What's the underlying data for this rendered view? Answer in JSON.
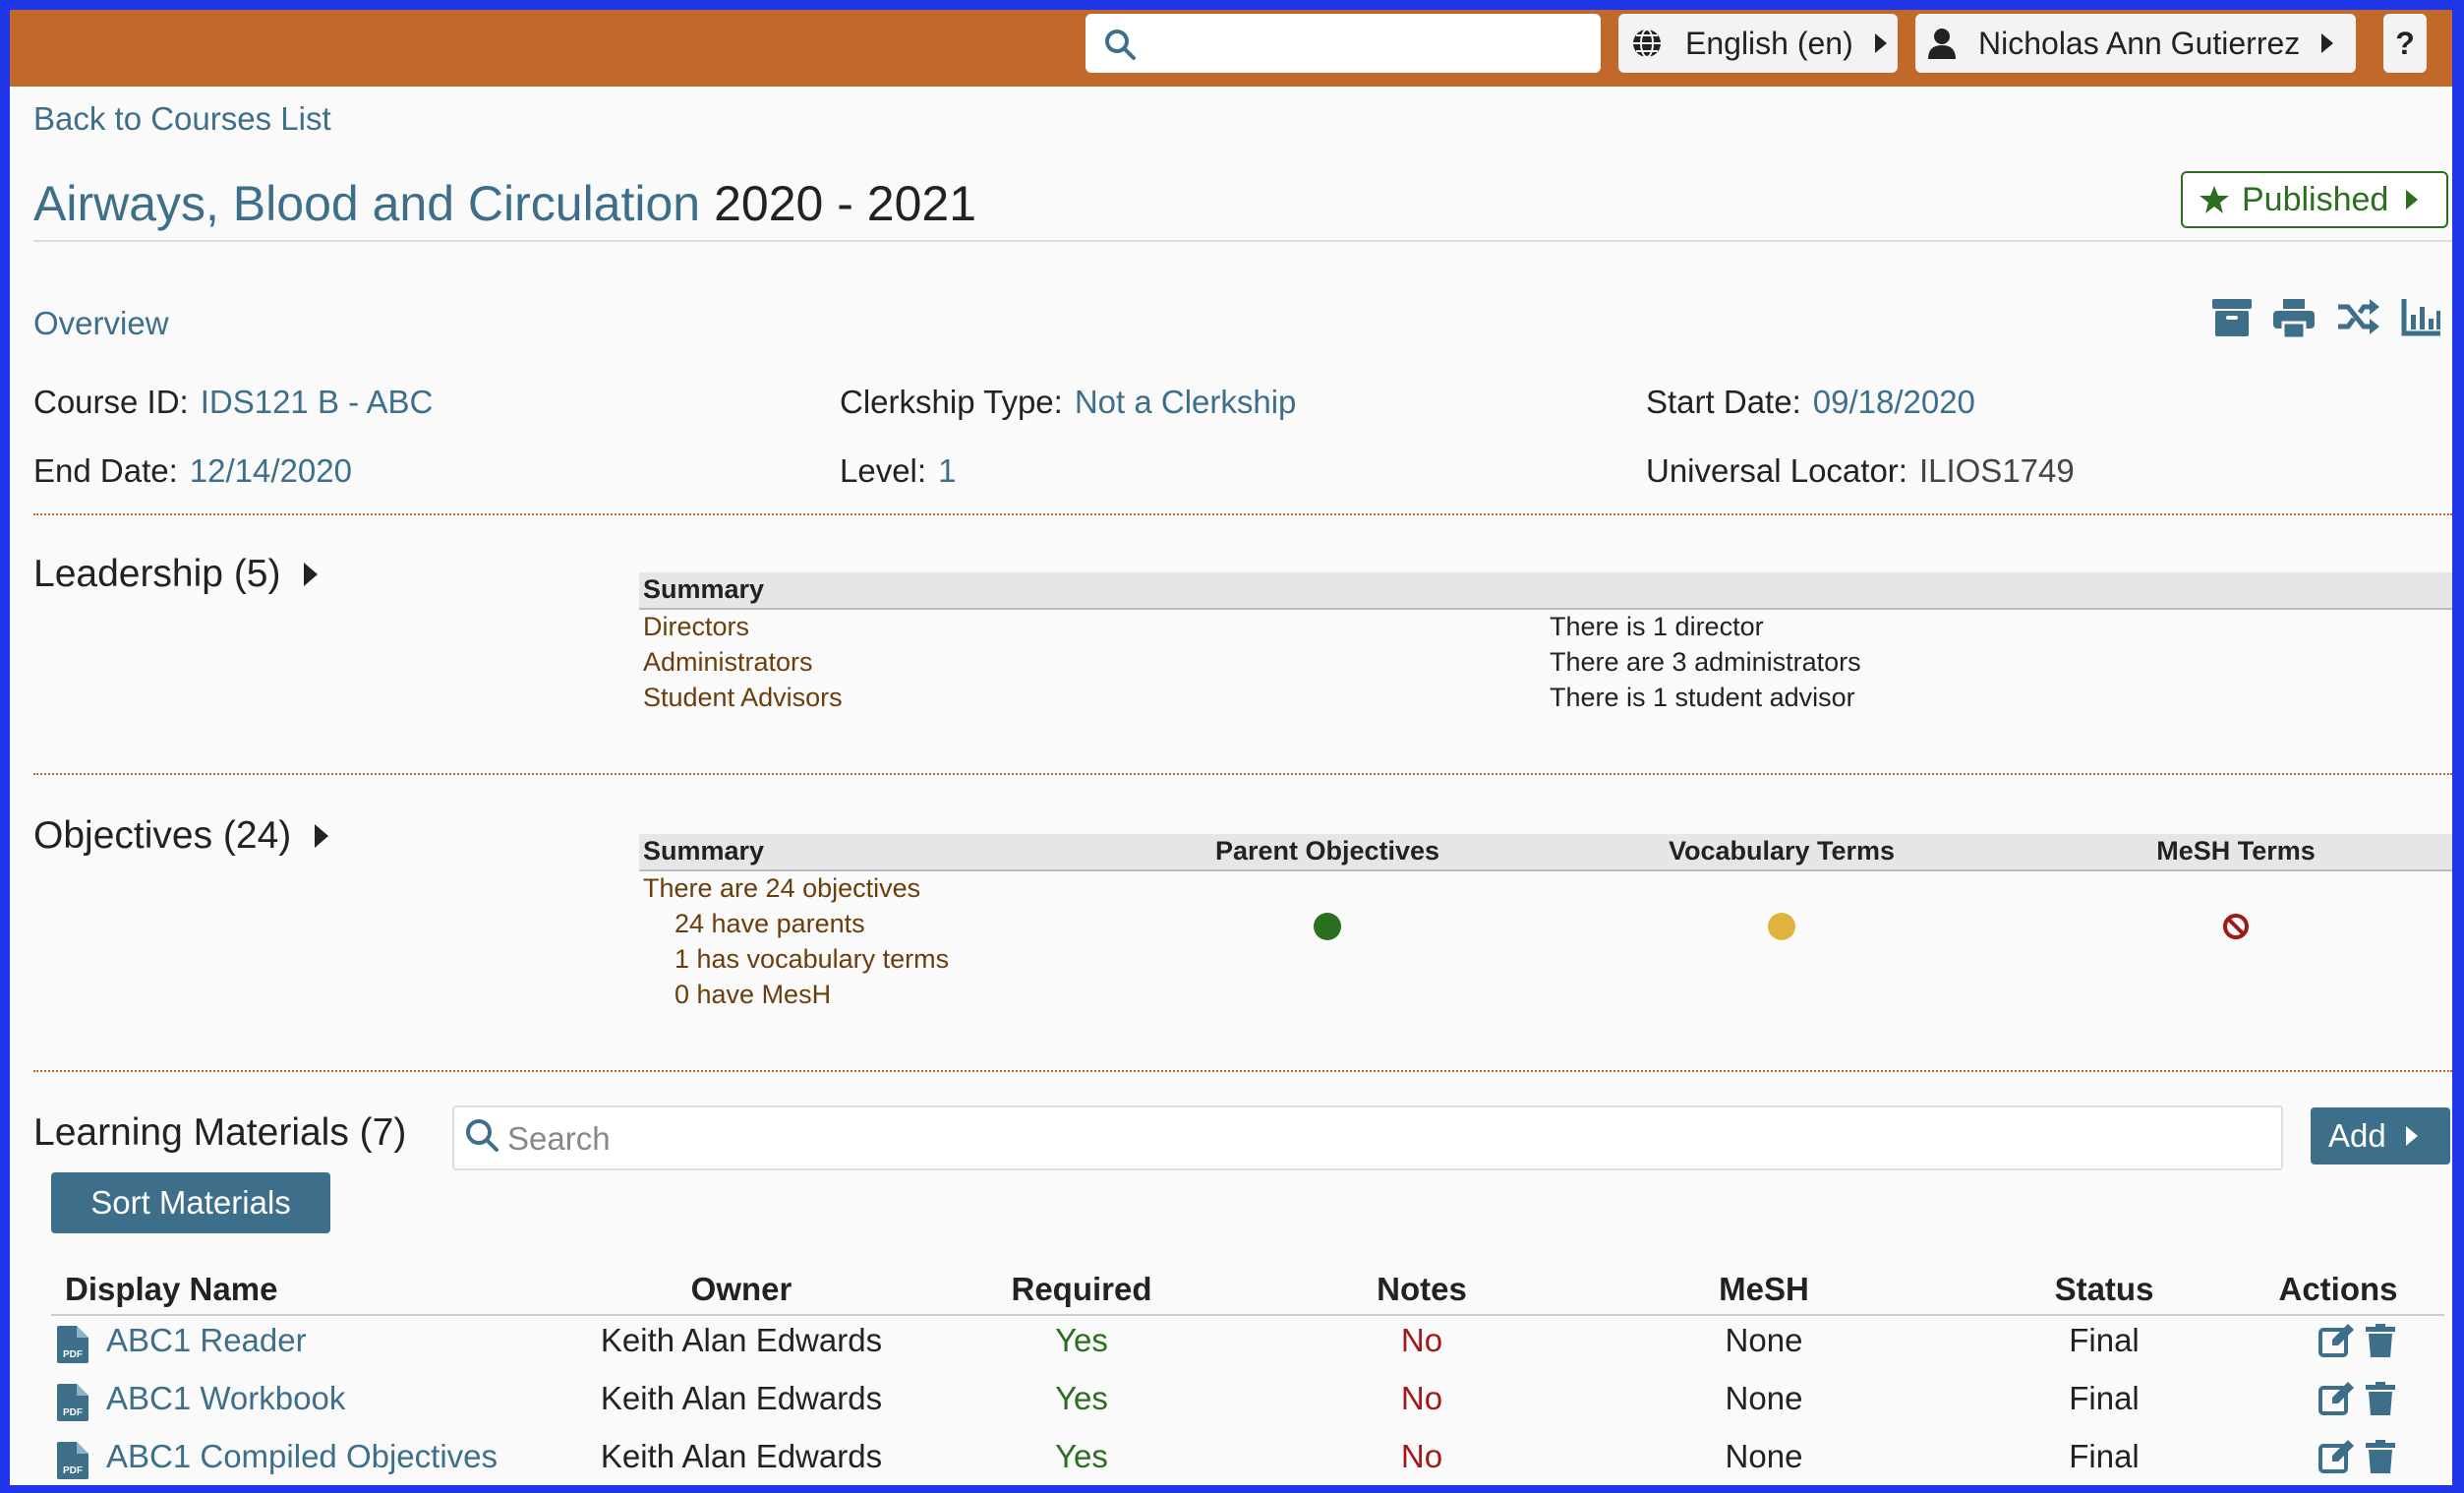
{
  "topbar": {
    "search_placeholder": "",
    "language": "English (en)",
    "user": "Nicholas Ann Gutierrez",
    "help": "?"
  },
  "back_link": "Back to Courses List",
  "course": {
    "title": "Airways, Blood and Circulation",
    "year": "2020 - 2021",
    "publish_status": "Published"
  },
  "overview": {
    "heading": "Overview",
    "fields": {
      "course_id_label": "Course ID:",
      "course_id": "IDS121 B - ABC",
      "clerkship_label": "Clerkship Type:",
      "clerkship": "Not a Clerkship",
      "start_label": "Start Date:",
      "start": "09/18/2020",
      "end_label": "End Date:",
      "end": "12/14/2020",
      "level_label": "Level:",
      "level": "1",
      "locator_label": "Universal Locator:",
      "locator": "ILIOS1749"
    }
  },
  "leadership": {
    "heading": "Leadership (5)",
    "summary_header": "Summary",
    "rows": [
      {
        "label": "Directors",
        "value": "There is 1 director"
      },
      {
        "label": "Administrators",
        "value": "There are 3 administrators"
      },
      {
        "label": "Student Advisors",
        "value": "There is 1 student advisor"
      }
    ]
  },
  "objectives": {
    "heading": "Objectives (24)",
    "headers": [
      "Summary",
      "Parent Objectives",
      "Vocabulary Terms",
      "MeSH Terms"
    ],
    "lines": [
      "There are 24 objectives",
      "24 have parents",
      "1 has vocabulary terms",
      "0 have MesH"
    ],
    "status_colors": {
      "parents": "#2c6e1f",
      "vocabulary": "#e0b43c",
      "mesh": "#a01818"
    }
  },
  "learning_materials": {
    "heading": "Learning Materials (7)",
    "search_placeholder": "Search",
    "add_label": "Add",
    "sort_label": "Sort Materials",
    "columns": [
      "Display Name",
      "Owner",
      "Required",
      "Notes",
      "MeSH",
      "Status",
      "Actions"
    ],
    "rows": [
      {
        "name": "ABC1 Reader",
        "owner": "Keith Alan Edwards",
        "required": "Yes",
        "notes": "No",
        "mesh": "None",
        "status": "Final"
      },
      {
        "name": "ABC1 Workbook",
        "owner": "Keith Alan Edwards",
        "required": "Yes",
        "notes": "No",
        "mesh": "None",
        "status": "Final"
      },
      {
        "name": "ABC1 Compiled Objectives",
        "owner": "Keith Alan Edwards",
        "required": "Yes",
        "notes": "No",
        "mesh": "None",
        "status": "Final"
      }
    ]
  }
}
